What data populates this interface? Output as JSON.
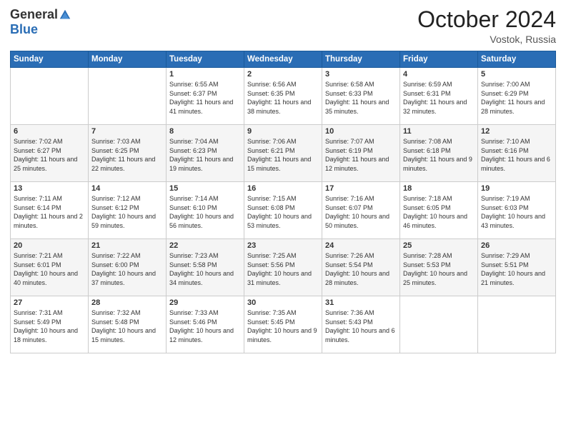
{
  "header": {
    "logo_general": "General",
    "logo_blue": "Blue",
    "month": "October 2024",
    "location": "Vostok, Russia"
  },
  "weekdays": [
    "Sunday",
    "Monday",
    "Tuesday",
    "Wednesday",
    "Thursday",
    "Friday",
    "Saturday"
  ],
  "weeks": [
    [
      {
        "day": "",
        "content": ""
      },
      {
        "day": "",
        "content": ""
      },
      {
        "day": "1",
        "content": "Sunrise: 6:55 AM\nSunset: 6:37 PM\nDaylight: 11 hours and 41 minutes."
      },
      {
        "day": "2",
        "content": "Sunrise: 6:56 AM\nSunset: 6:35 PM\nDaylight: 11 hours and 38 minutes."
      },
      {
        "day": "3",
        "content": "Sunrise: 6:58 AM\nSunset: 6:33 PM\nDaylight: 11 hours and 35 minutes."
      },
      {
        "day": "4",
        "content": "Sunrise: 6:59 AM\nSunset: 6:31 PM\nDaylight: 11 hours and 32 minutes."
      },
      {
        "day": "5",
        "content": "Sunrise: 7:00 AM\nSunset: 6:29 PM\nDaylight: 11 hours and 28 minutes."
      }
    ],
    [
      {
        "day": "6",
        "content": "Sunrise: 7:02 AM\nSunset: 6:27 PM\nDaylight: 11 hours and 25 minutes."
      },
      {
        "day": "7",
        "content": "Sunrise: 7:03 AM\nSunset: 6:25 PM\nDaylight: 11 hours and 22 minutes."
      },
      {
        "day": "8",
        "content": "Sunrise: 7:04 AM\nSunset: 6:23 PM\nDaylight: 11 hours and 19 minutes."
      },
      {
        "day": "9",
        "content": "Sunrise: 7:06 AM\nSunset: 6:21 PM\nDaylight: 11 hours and 15 minutes."
      },
      {
        "day": "10",
        "content": "Sunrise: 7:07 AM\nSunset: 6:19 PM\nDaylight: 11 hours and 12 minutes."
      },
      {
        "day": "11",
        "content": "Sunrise: 7:08 AM\nSunset: 6:18 PM\nDaylight: 11 hours and 9 minutes."
      },
      {
        "day": "12",
        "content": "Sunrise: 7:10 AM\nSunset: 6:16 PM\nDaylight: 11 hours and 6 minutes."
      }
    ],
    [
      {
        "day": "13",
        "content": "Sunrise: 7:11 AM\nSunset: 6:14 PM\nDaylight: 11 hours and 2 minutes."
      },
      {
        "day": "14",
        "content": "Sunrise: 7:12 AM\nSunset: 6:12 PM\nDaylight: 10 hours and 59 minutes."
      },
      {
        "day": "15",
        "content": "Sunrise: 7:14 AM\nSunset: 6:10 PM\nDaylight: 10 hours and 56 minutes."
      },
      {
        "day": "16",
        "content": "Sunrise: 7:15 AM\nSunset: 6:08 PM\nDaylight: 10 hours and 53 minutes."
      },
      {
        "day": "17",
        "content": "Sunrise: 7:16 AM\nSunset: 6:07 PM\nDaylight: 10 hours and 50 minutes."
      },
      {
        "day": "18",
        "content": "Sunrise: 7:18 AM\nSunset: 6:05 PM\nDaylight: 10 hours and 46 minutes."
      },
      {
        "day": "19",
        "content": "Sunrise: 7:19 AM\nSunset: 6:03 PM\nDaylight: 10 hours and 43 minutes."
      }
    ],
    [
      {
        "day": "20",
        "content": "Sunrise: 7:21 AM\nSunset: 6:01 PM\nDaylight: 10 hours and 40 minutes."
      },
      {
        "day": "21",
        "content": "Sunrise: 7:22 AM\nSunset: 6:00 PM\nDaylight: 10 hours and 37 minutes."
      },
      {
        "day": "22",
        "content": "Sunrise: 7:23 AM\nSunset: 5:58 PM\nDaylight: 10 hours and 34 minutes."
      },
      {
        "day": "23",
        "content": "Sunrise: 7:25 AM\nSunset: 5:56 PM\nDaylight: 10 hours and 31 minutes."
      },
      {
        "day": "24",
        "content": "Sunrise: 7:26 AM\nSunset: 5:54 PM\nDaylight: 10 hours and 28 minutes."
      },
      {
        "day": "25",
        "content": "Sunrise: 7:28 AM\nSunset: 5:53 PM\nDaylight: 10 hours and 25 minutes."
      },
      {
        "day": "26",
        "content": "Sunrise: 7:29 AM\nSunset: 5:51 PM\nDaylight: 10 hours and 21 minutes."
      }
    ],
    [
      {
        "day": "27",
        "content": "Sunrise: 7:31 AM\nSunset: 5:49 PM\nDaylight: 10 hours and 18 minutes."
      },
      {
        "day": "28",
        "content": "Sunrise: 7:32 AM\nSunset: 5:48 PM\nDaylight: 10 hours and 15 minutes."
      },
      {
        "day": "29",
        "content": "Sunrise: 7:33 AM\nSunset: 5:46 PM\nDaylight: 10 hours and 12 minutes."
      },
      {
        "day": "30",
        "content": "Sunrise: 7:35 AM\nSunset: 5:45 PM\nDaylight: 10 hours and 9 minutes."
      },
      {
        "day": "31",
        "content": "Sunrise: 7:36 AM\nSunset: 5:43 PM\nDaylight: 10 hours and 6 minutes."
      },
      {
        "day": "",
        "content": ""
      },
      {
        "day": "",
        "content": ""
      }
    ]
  ]
}
